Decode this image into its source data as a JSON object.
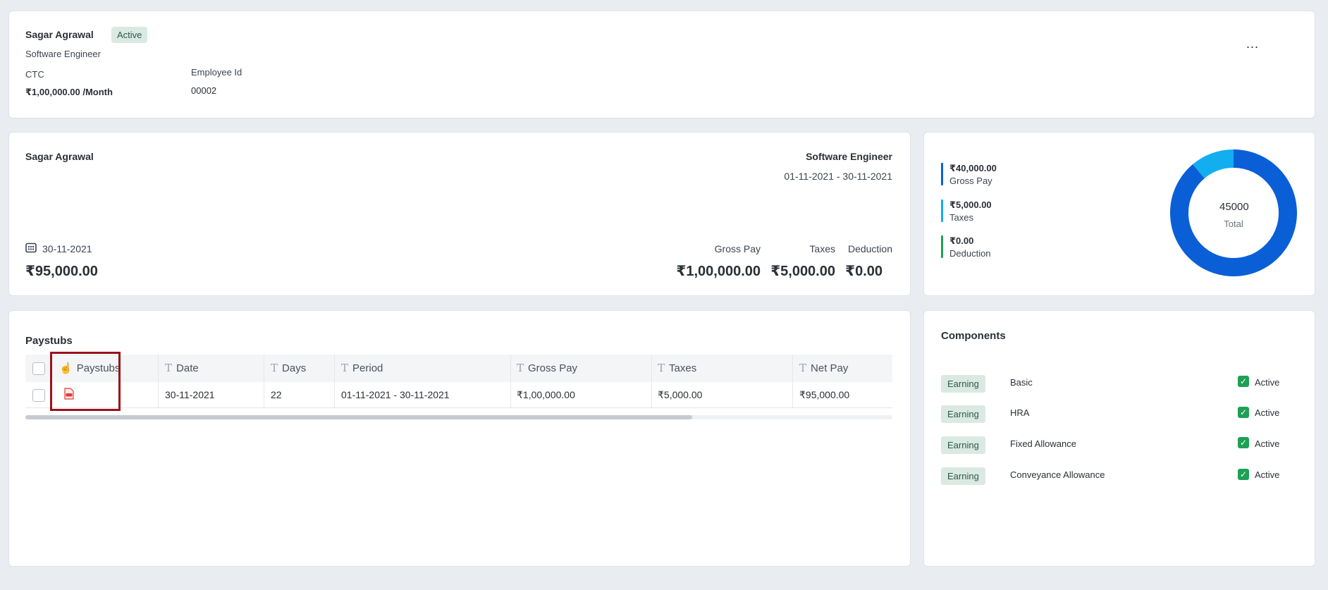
{
  "header": {
    "name": "Sagar Agrawal",
    "status": "Active",
    "role": "Software Engineer",
    "ctc_label": "CTC",
    "ctc_value": "₹1,00,000.00 /Month",
    "employee_id_label": "Employee Id",
    "employee_id_value": "00002",
    "more_label": "..."
  },
  "summary": {
    "name": "Sagar Agrawal",
    "role": "Software Engineer",
    "period": "01-11-2021 - 30-11-2021",
    "date": "30-11-2021",
    "net_pay": "₹95,000.00",
    "gross_pay_label": "Gross Pay",
    "gross_pay_value": "₹1,00,000.00",
    "taxes_label": "Taxes",
    "taxes_value": "₹5,000.00",
    "deduction_label": "Deduction",
    "deduction_value": "₹0.00"
  },
  "breakdown": {
    "legend": [
      {
        "value": "₹40,000.00",
        "label": "Gross Pay",
        "color": "#0a5fd6"
      },
      {
        "value": "₹5,000.00",
        "label": "Taxes",
        "color": "#12aef0"
      },
      {
        "value": "₹0.00",
        "label": "Deduction",
        "color": "#1fa055"
      }
    ],
    "total_value": "45000",
    "total_label": "Total"
  },
  "chart_data": {
    "type": "pie",
    "donut": true,
    "categories": [
      "Gross Pay",
      "Taxes",
      "Deduction"
    ],
    "values": [
      40000,
      5000,
      0
    ],
    "colors": [
      "#0a5fd6",
      "#12aef0",
      "#1fa055"
    ],
    "center_text": "45000",
    "center_label": "Total"
  },
  "paystubs": {
    "title": "Paystubs",
    "columns": [
      "Paystubs",
      "Date",
      "Days",
      "Period",
      "Gross Pay",
      "Taxes",
      "Net Pay"
    ],
    "rows": [
      {
        "date": "30-11-2021",
        "days": "22",
        "period": "01-11-2021 - 30-11-2021",
        "gross_pay": "₹1,00,000.00",
        "taxes": "₹5,000.00",
        "net_pay": "₹95,000.00"
      }
    ]
  },
  "components": {
    "title": "Components",
    "items": [
      {
        "type": "Earning",
        "name": "Basic",
        "status": "Active"
      },
      {
        "type": "Earning",
        "name": "HRA",
        "status": "Active"
      },
      {
        "type": "Earning",
        "name": "Fixed Allowance",
        "status": "Active"
      },
      {
        "type": "Earning",
        "name": "Conveyance Allowance",
        "status": "Active"
      }
    ]
  }
}
